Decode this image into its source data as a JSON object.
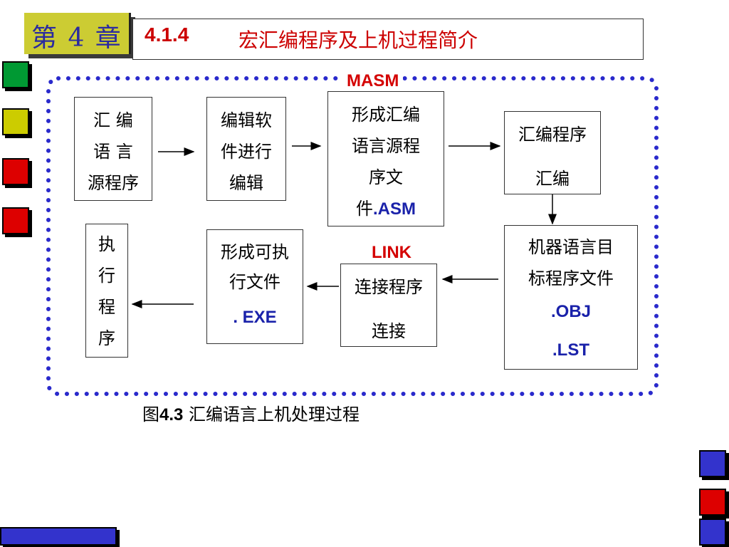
{
  "chapter": {
    "label": "第 4 章"
  },
  "title": {
    "number": "4.1.4",
    "text": "宏汇编程序及上机过程简介"
  },
  "diagram": {
    "labels": {
      "masm": "MASM",
      "link": "LINK"
    },
    "boxes": {
      "source": [
        "汇 编",
        "语 言",
        "源程序"
      ],
      "editor": [
        "编辑软",
        "件进行",
        "编辑"
      ],
      "asm_file": [
        "形成汇编",
        "语言源程",
        "序文"
      ],
      "asm_file_last": {
        "prefix": "件",
        "ext": ".ASM"
      },
      "assemble": {
        "top": "汇编程序",
        "bottom": "汇编"
      },
      "object": [
        "机器语言目",
        "标程序文件"
      ],
      "object_ext": [
        ".OBJ",
        ".LST"
      ],
      "linker": {
        "top": "连接程序",
        "bottom": "连接"
      },
      "exe": [
        "形成可执",
        "行文件"
      ],
      "exe_ext": ". EXE",
      "run": [
        "执",
        "行",
        "程",
        "序"
      ]
    },
    "caption": {
      "prefix": "图",
      "number": "4.3",
      "text": " 汇编语言上机处理过程"
    }
  },
  "colors": {
    "badge": "#cccc33",
    "title_red": "#cc0000",
    "dots": "#2a2acc",
    "green": "#009933",
    "yellow": "#cccc00",
    "red": "#dd0000",
    "blue": "#3333cc"
  }
}
